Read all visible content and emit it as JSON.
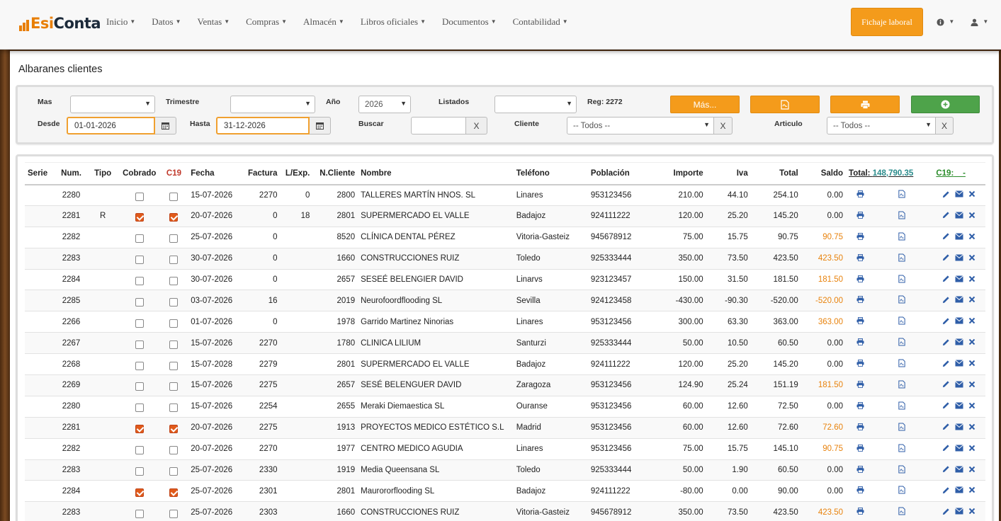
{
  "nav": {
    "brand_es": "Esi",
    "brand_conta": "Conta",
    "menu": [
      "Inicio",
      "Datos",
      "Ventas",
      "Compras",
      "Almacén",
      "Libros oficiales",
      "Documentos",
      "Contabilidad"
    ],
    "fichaje_label": "Fichaje laboral"
  },
  "page": {
    "title": "Albaranes clientes"
  },
  "filters": {
    "mas_label": "Mas",
    "trimestre_label": "Trimestre",
    "anio_label": "Año",
    "anio_value": "2026",
    "listados_label": "Listados",
    "reg_label": "Reg: 2272",
    "mas_button": "Más...",
    "desde_label": "Desde",
    "desde_value": "01-01-2026",
    "hasta_label": "Hasta",
    "hasta_value": "31-12-2026",
    "buscar_label": "Buscar",
    "clear_x": "X",
    "cliente_label": "Cliente",
    "cliente_value": "-- Todos --",
    "articulo_label": "Articulo",
    "articulo_value": "-- Todos --"
  },
  "table": {
    "headers": {
      "serie": "Serie",
      "num": "Num.",
      "tipo": "Tipo",
      "cobrado": "Cobrado",
      "c19": "C19",
      "fecha": "Fecha",
      "factura": "Factura",
      "lexp": "L/Exp.",
      "ncliente": "N.Cliente",
      "nombre": "Nombre",
      "telefono": "Teléfono",
      "poblacion": "Población",
      "importe": "Importe",
      "iva": "Iva",
      "total": "Total",
      "saldo": "Saldo",
      "total_label": "Total:",
      "total_value": "148,790.35",
      "c19_summary": "C19:",
      "c19_dash": "-"
    },
    "rows": [
      {
        "num": "2280",
        "tipo": "",
        "cobrado": false,
        "c19": false,
        "fecha": "15-07-2026",
        "factura": "2270",
        "lexp": "0",
        "ncliente": "2800",
        "nombre": "TALLERES MARTÍN HNOS. SL",
        "telefono": "Linares",
        "poblacion": "953123456",
        "importe": "210.00",
        "iva": "44.10",
        "total": "254.10",
        "saldo": "0.00",
        "saldo_pending": false
      },
      {
        "num": "2281",
        "tipo": "R",
        "cobrado": true,
        "c19": true,
        "fecha": "20-07-2026",
        "factura": "0",
        "lexp": "18",
        "ncliente": "2801",
        "nombre": "SUPERMERCADO EL VALLE",
        "telefono": "Badajoz",
        "poblacion": "924111222",
        "importe": "120.00",
        "iva": "25.20",
        "total": "145.20",
        "saldo": "0.00",
        "saldo_pending": false
      },
      {
        "num": "2282",
        "tipo": "",
        "cobrado": false,
        "c19": false,
        "fecha": "25-07-2026",
        "factura": "0",
        "lexp": "",
        "ncliente": "8520",
        "nombre": "CLÍNICA DENTAL PÉREZ",
        "telefono": "Vitoria-Gasteiz",
        "poblacion": "945678912",
        "importe": "75.00",
        "iva": "15.75",
        "total": "90.75",
        "saldo": "90.75",
        "saldo_pending": true
      },
      {
        "num": "2283",
        "tipo": "",
        "cobrado": false,
        "c19": false,
        "fecha": "30-07-2026",
        "factura": "0",
        "lexp": "",
        "ncliente": "1660",
        "nombre": "CONSTRUCCIONES RUIZ",
        "telefono": "Toledo",
        "poblacion": "925333444",
        "importe": "350.00",
        "iva": "73.50",
        "total": "423.50",
        "saldo": "423.50",
        "saldo_pending": true
      },
      {
        "num": "2284",
        "tipo": "",
        "cobrado": false,
        "c19": false,
        "fecha": "30-07-2026",
        "factura": "0",
        "lexp": "",
        "ncliente": "2657",
        "nombre": "SESEÉ BELENGIER DAVID",
        "telefono": "Linarvs",
        "poblacion": "923123457",
        "importe": "150.00",
        "iva": "31.50",
        "total": "181.50",
        "saldo": "181.50",
        "saldo_pending": true
      },
      {
        "num": "2285",
        "tipo": "",
        "cobrado": false,
        "c19": false,
        "fecha": "03-07-2026",
        "factura": "16",
        "lexp": "",
        "ncliente": "2019",
        "nombre": "Neurofoordflooding SL",
        "telefono": "Sevilla",
        "poblacion": "924123458",
        "importe": "-430.00",
        "iva": "-90.30",
        "total": "-520.00",
        "saldo": "-520.00",
        "saldo_pending": true
      },
      {
        "num": "2266",
        "tipo": "",
        "cobrado": false,
        "c19": false,
        "fecha": "01-07-2026",
        "factura": "0",
        "lexp": "",
        "ncliente": "1978",
        "nombre": "Garrido Martinez Ninorias",
        "telefono": "Linares",
        "poblacion": "953123456",
        "importe": "300.00",
        "iva": "63.30",
        "total": "363.00",
        "saldo": "363.00",
        "saldo_pending": true
      },
      {
        "num": "2267",
        "tipo": "",
        "cobrado": false,
        "c19": false,
        "fecha": "15-07-2026",
        "factura": "2270",
        "lexp": "",
        "ncliente": "1780",
        "nombre": "CLINICA LILIUM",
        "telefono": "Santurzi",
        "poblacion": "925333444",
        "importe": "50.00",
        "iva": "10.50",
        "total": "60.50",
        "saldo": "0.00",
        "saldo_pending": false
      },
      {
        "num": "2268",
        "tipo": "",
        "cobrado": false,
        "c19": false,
        "fecha": "15-07-2028",
        "factura": "2279",
        "lexp": "",
        "ncliente": "2801",
        "nombre": "SUPERMERCADO EL VALLE",
        "telefono": "Badajoz",
        "poblacion": "924111222",
        "importe": "120.00",
        "iva": "25.20",
        "total": "145.20",
        "saldo": "0.00",
        "saldo_pending": false
      },
      {
        "num": "2269",
        "tipo": "",
        "cobrado": false,
        "c19": false,
        "fecha": "15-07-2026",
        "factura": "2275",
        "lexp": "",
        "ncliente": "2657",
        "nombre": "SESÉ BELENGUER DAVID",
        "telefono": "Zaragoza",
        "poblacion": "953123456",
        "importe": "124.90",
        "iva": "25.24",
        "total": "151.19",
        "saldo": "181.50",
        "saldo_pending": true
      },
      {
        "num": "2280",
        "tipo": "",
        "cobrado": false,
        "c19": false,
        "fecha": "15-07-2026",
        "factura": "2254",
        "lexp": "",
        "ncliente": "2655",
        "nombre": "Meraki Diemaestica SL",
        "telefono": "Ouranse",
        "poblacion": "953123456",
        "importe": "60.00",
        "iva": "12.60",
        "total": "72.50",
        "saldo": "0.00",
        "saldo_pending": false
      },
      {
        "num": "2281",
        "tipo": "",
        "cobrado": true,
        "c19": true,
        "fecha": "20-07-2026",
        "factura": "2275",
        "lexp": "",
        "ncliente": "1913",
        "nombre": "PROYECTOS MEDICO ESTÉTICO S.L",
        "telefono": "Madrid",
        "poblacion": "953123456",
        "importe": "60.00",
        "iva": "12.60",
        "total": "72.60",
        "saldo": "72.60",
        "saldo_pending": true
      },
      {
        "num": "2282",
        "tipo": "",
        "cobrado": false,
        "c19": false,
        "fecha": "20-07-2026",
        "factura": "2270",
        "lexp": "",
        "ncliente": "1977",
        "nombre": "CENTRO MEDICO AGUDIA",
        "telefono": "Linares",
        "poblacion": "953123456",
        "importe": "75.00",
        "iva": "15.75",
        "total": "145.10",
        "saldo": "90.75",
        "saldo_pending": true
      },
      {
        "num": "2283",
        "tipo": "",
        "cobrado": false,
        "c19": false,
        "fecha": "25-07-2026",
        "factura": "2330",
        "lexp": "",
        "ncliente": "1919",
        "nombre": "Media Queensana SL",
        "telefono": "Toledo",
        "poblacion": "925333444",
        "importe": "50.00",
        "iva": "1.90",
        "total": "60.50",
        "saldo": "0.00",
        "saldo_pending": false
      },
      {
        "num": "2284",
        "tipo": "",
        "cobrado": true,
        "c19": true,
        "fecha": "25-07-2026",
        "factura": "2301",
        "lexp": "",
        "ncliente": "2801",
        "nombre": "Maurororflooding SL",
        "telefono": "Badajoz",
        "poblacion": "924111222",
        "importe": "-80.00",
        "iva": "0.00",
        "total": "90.00",
        "saldo": "0.00",
        "saldo_pending": false
      },
      {
        "num": "2283",
        "tipo": "",
        "cobrado": false,
        "c19": false,
        "fecha": "25-07-2026",
        "factura": "2303",
        "lexp": "",
        "ncliente": "1660",
        "nombre": "CONSTRUCCIONES RUIZ",
        "telefono": "Vitoria-Gasteiz",
        "poblacion": "945678912",
        "importe": "350.00",
        "iva": "73.50",
        "total": "423.50",
        "saldo": "423.50",
        "saldo_pending": true
      }
    ]
  },
  "colors": {
    "accent": "#f49b1b",
    "green": "#4ea34a",
    "pending": "#e8820c",
    "c19": "#c0392b"
  }
}
